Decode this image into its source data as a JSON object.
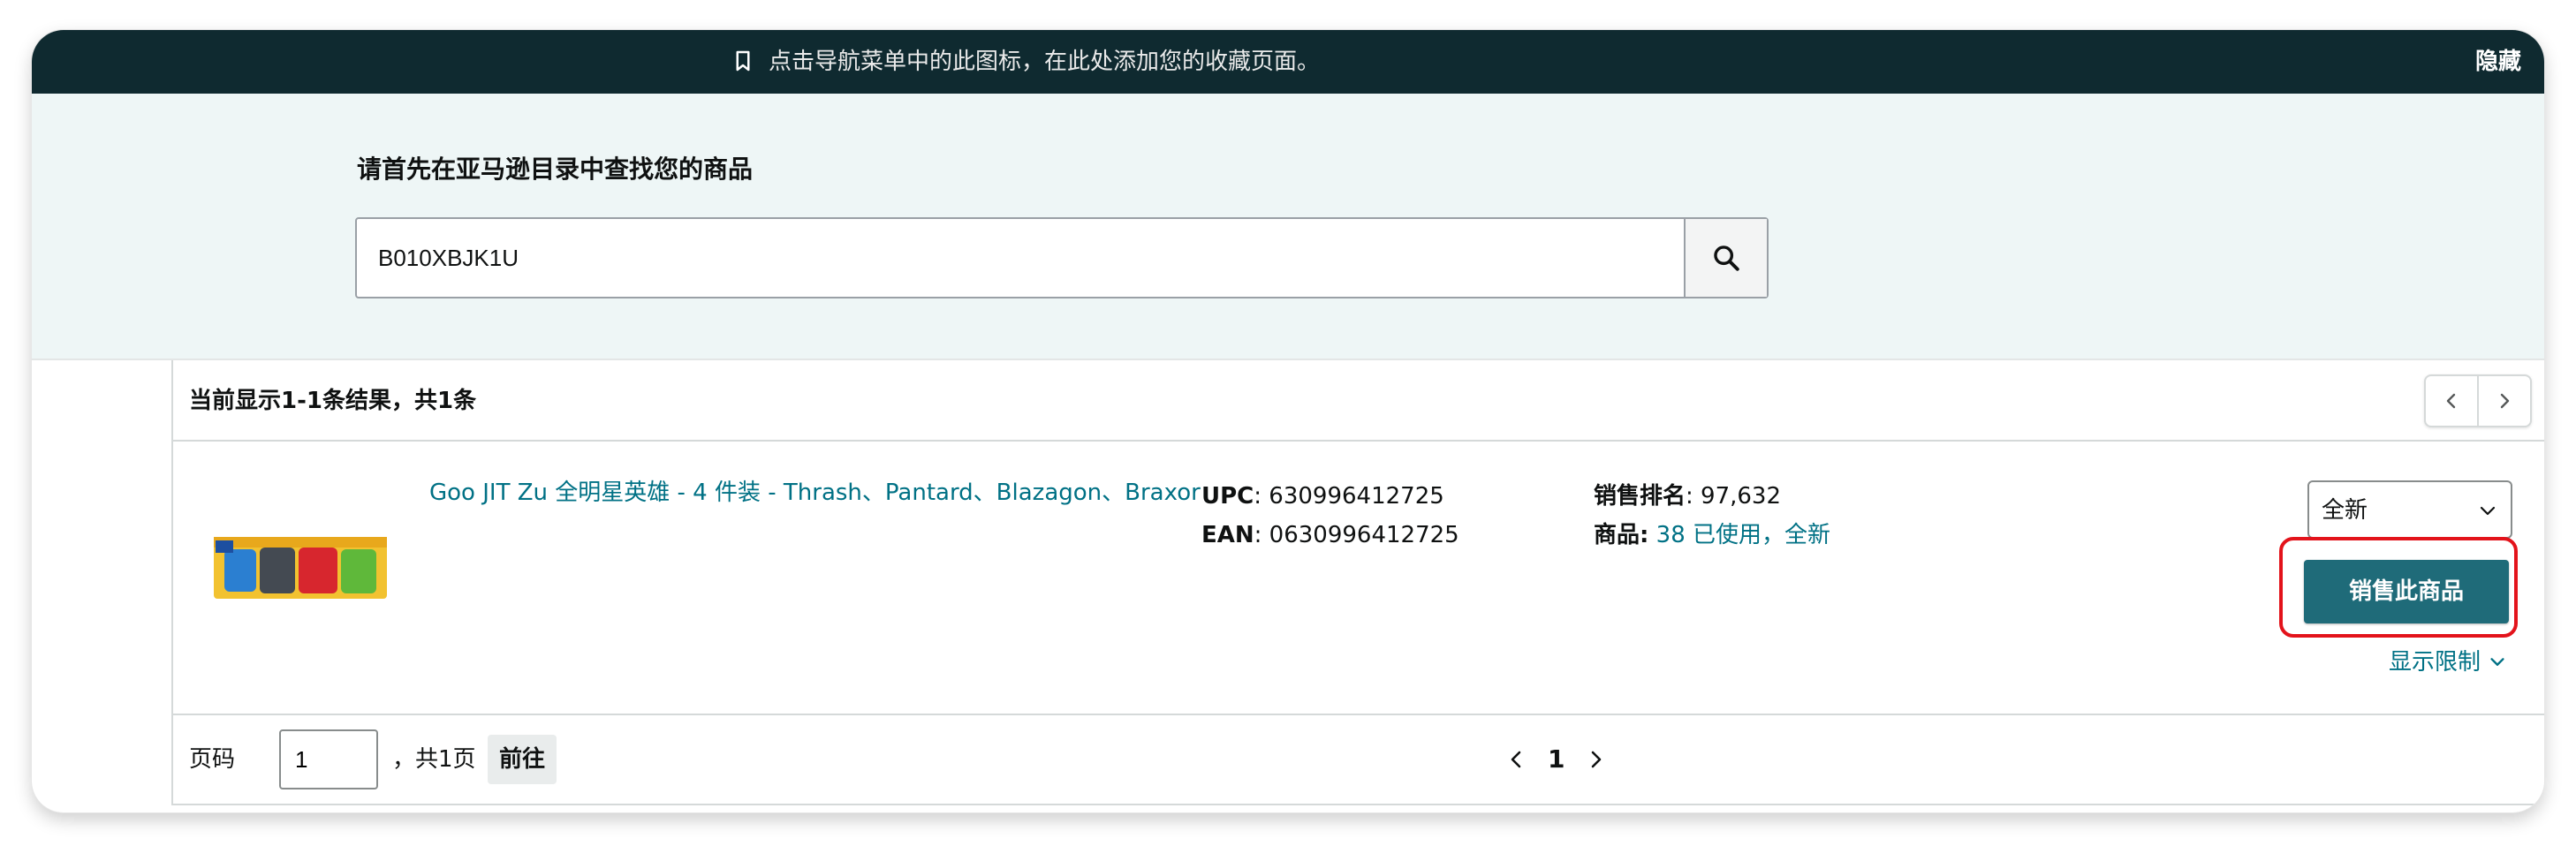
{
  "banner": {
    "message": "点击导航菜单中的此图标，在此处添加您的收藏页面。",
    "hide_label": "隐藏",
    "icon": "bookmark-icon"
  },
  "search": {
    "title": "请首先在亚马逊目录中查找您的商品",
    "value": "B010XBJK1U",
    "icon": "search-icon"
  },
  "results": {
    "summary": "当前显示1-1条结果，共1条"
  },
  "product": {
    "title": "Goo JIT Zu 全明星英雄 - 4 件装 - Thrash、Pantard、Blazagon、Braxor",
    "upc_label": "UPC",
    "upc_value": ": 630996412725",
    "ean_label": "EAN",
    "ean_value": ": 0630996412725",
    "rank_label": "销售排名",
    "rank_value": ": 97,632",
    "offers_label": "商品:",
    "offers_value": "38 已使用，全新",
    "condition": "全新",
    "sell_label": "销售此商品",
    "restrictions_label": "显示限制"
  },
  "pagination": {
    "page_label": "页码",
    "page_input": "1",
    "total": "，共1页",
    "go_label": "前往",
    "current_page": "1"
  },
  "colors": {
    "banner_bg": "#0f2a30",
    "search_bg": "#eef6f6",
    "link": "#007185",
    "sell_button": "#1f6b79",
    "highlight": "#e3131b"
  }
}
